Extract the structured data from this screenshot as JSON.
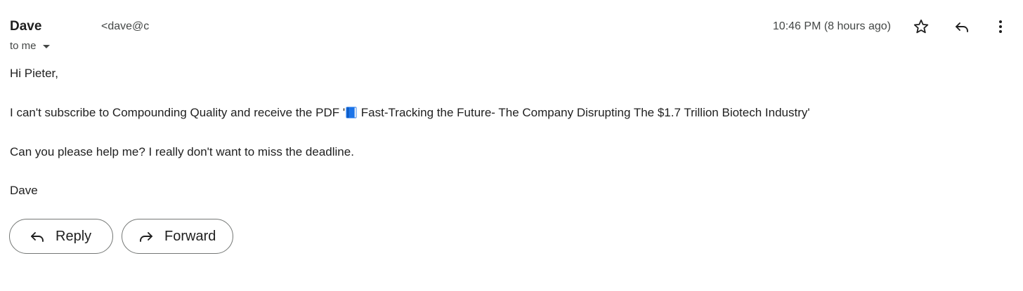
{
  "sender": {
    "name": "Dave",
    "email": "<dave@c"
  },
  "recipient": {
    "label": "to me"
  },
  "timestamp": "10:46 PM (8 hours ago)",
  "toolbar": {
    "star_icon": "star-outline-icon",
    "reply_icon": "reply-arrow-icon",
    "more_icon": "more-vertical-icon"
  },
  "message": {
    "greeting": "Hi Pieter,",
    "line_before_emoji": "I can't subscribe to Compounding Quality and receive the PDF '",
    "line_after_emoji": " Fast-Tracking the Future- The Company Disrupting The $1.7 Trillion Biotech Industry'",
    "emoji_name": "blue-book-emoji",
    "request": "Can you please help me? I really don't want to miss the deadline.",
    "signoff": "Dave"
  },
  "actions": {
    "reply_label": "Reply",
    "forward_label": "Forward"
  },
  "colors": {
    "text": "#1f1f1f",
    "secondary_text": "#444746",
    "button_border": "#747775",
    "book_blue": "#1a73e8"
  }
}
